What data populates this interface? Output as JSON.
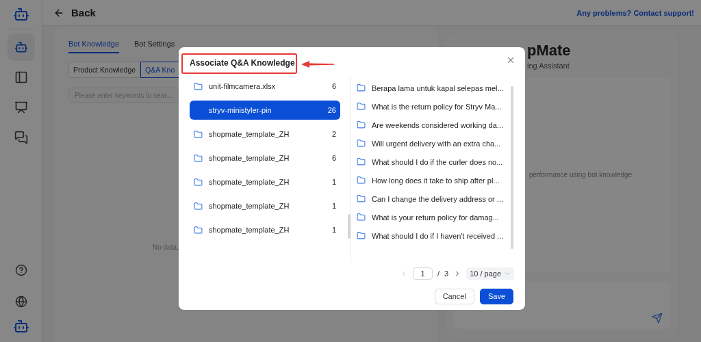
{
  "sidebar": {
    "nav": [
      {
        "selected": true
      },
      {
        "selected": false
      },
      {
        "selected": false
      },
      {
        "selected": false
      }
    ]
  },
  "header": {
    "back": "Back",
    "support_link": "Any problems? Contact support!"
  },
  "page_tabs": [
    {
      "label": "Bot Knowledge",
      "selected": true
    },
    {
      "label": "Bot Settings",
      "selected": false
    }
  ],
  "knowledge_types": [
    {
      "label": "Product Knowledge",
      "selected": false
    },
    {
      "label": "Q&A Kno",
      "selected": true
    }
  ],
  "search": {
    "placeholder": "Please enter keywords to sear..."
  },
  "empty_text": "No data,",
  "preview": {
    "title": "pMate",
    "subtitle": "ing Assistant",
    "hint": "performance using bot knowledge"
  },
  "dialog": {
    "title": "Associate Q&A Knowledge",
    "title_highlighted": true,
    "files": [
      {
        "name": "unit-filmcamera.xlsx",
        "count": "6",
        "selected": false
      },
      {
        "name": "stryv-ministyler-pin",
        "count": "26",
        "selected": true
      },
      {
        "name": "shopmate_template_ZH",
        "count": "2",
        "selected": false
      },
      {
        "name": "shopmate_template_ZH",
        "count": "6",
        "selected": false
      },
      {
        "name": "shopmate_template_ZH",
        "count": "1",
        "selected": false
      },
      {
        "name": "shopmate_template_ZH",
        "count": "1",
        "selected": false
      },
      {
        "name": "shopmate_template_ZH",
        "count": "1",
        "selected": false
      }
    ],
    "questions": [
      "Berapa lama untuk kapal selepas mel...",
      "What is the return policy for Stryv Ma...",
      "Are weekends considered working da...",
      "Will urgent delivery with an extra cha...",
      "What should I do if the curler does no...",
      "How long does it take to ship after pl...",
      "Can I change the delivery address or ...",
      "What is your return policy for damag...",
      "What should I do if I haven't received ..."
    ],
    "pagination": {
      "prev_disabled": true,
      "page": "1",
      "divider": "/",
      "total": "3",
      "page_size": "10 / page"
    },
    "cancel": "Cancel",
    "save": "Save"
  }
}
